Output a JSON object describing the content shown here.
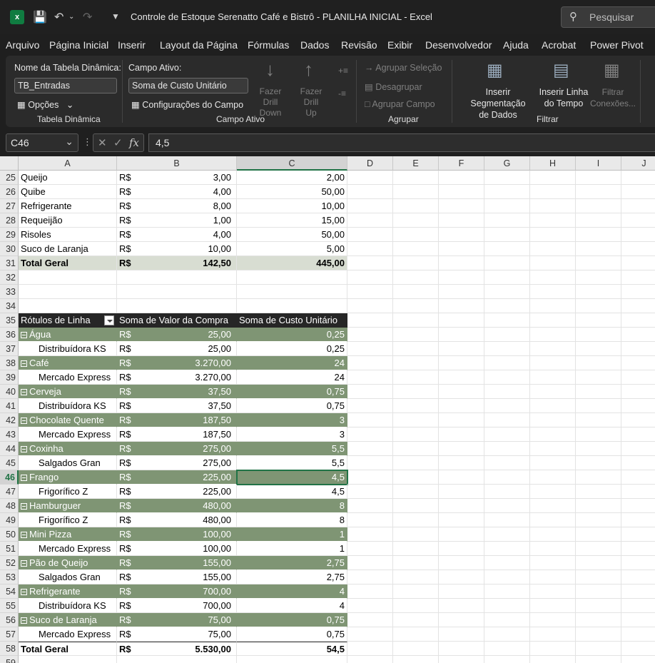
{
  "app": {
    "title": "Controle de Estoque Serenatto Café e Bistrô - PLANILHA INICIAL  -  Excel",
    "icon": "excel-icon",
    "search_placeholder": "Pesquisar"
  },
  "menu": [
    "Arquivo",
    "Página Inicial",
    "Inserir",
    "Layout da Página",
    "Fórmulas",
    "Dados",
    "Revisão",
    "Exibir",
    "Desenvolvedor",
    "Ajuda",
    "Acrobat",
    "Power Pivot"
  ],
  "ribbon": {
    "pivot_name_label": "Nome da Tabela Dinâmica:",
    "pivot_name_value": "TB_Entradas",
    "options_label": "Opções",
    "group_pivot": "Tabela Dinâmica",
    "active_field_label": "Campo Ativo:",
    "active_field_value": "Soma de Custo Unitário",
    "field_settings_label": "Configurações do Campo",
    "drill_down_1": "Fazer Drill",
    "drill_down_2": "Down",
    "drill_up_1": "Fazer Drill",
    "drill_up_2": "Up",
    "group_active_field": "Campo Ativo",
    "group_selection": "Agrupar Seleção",
    "ungroup": "Desagrupar",
    "group_field": "Agrupar Campo",
    "group_group": "Agrupar",
    "insert_slicer_1": "Inserir Segmentação",
    "insert_slicer_2": "de Dados",
    "insert_timeline_1": "Inserir Linha",
    "insert_timeline_2": "do Tempo",
    "filter_conn_1": "Filtrar",
    "filter_conn_2": "Conexões...",
    "group_filter": "Filtrar"
  },
  "formula_bar": {
    "name_box": "C46",
    "formula": "4,5"
  },
  "columns": [
    "A",
    "B",
    "C",
    "D",
    "E",
    "F",
    "G",
    "H",
    "I",
    "J"
  ],
  "rows": [
    {
      "n": "25",
      "type": "plain",
      "a": "Queijo",
      "cur": "R$",
      "b": "3,00",
      "c": "2,00"
    },
    {
      "n": "26",
      "type": "plain",
      "a": "Quibe",
      "cur": "R$",
      "b": "4,00",
      "c": "50,00"
    },
    {
      "n": "27",
      "type": "plain",
      "a": "Refrigerante",
      "cur": "R$",
      "b": "8,00",
      "c": "10,00"
    },
    {
      "n": "28",
      "type": "plain",
      "a": "Requeijão",
      "cur": "R$",
      "b": "1,00",
      "c": "15,00"
    },
    {
      "n": "29",
      "type": "plain",
      "a": "Risoles",
      "cur": "R$",
      "b": "4,00",
      "c": "50,00"
    },
    {
      "n": "30",
      "type": "plain",
      "a": "Suco de Laranja",
      "cur": "R$",
      "b": "10,00",
      "c": "5,00"
    },
    {
      "n": "31",
      "type": "total1",
      "a": "Total Geral",
      "cur": "R$",
      "b": "142,50",
      "c": "445,00"
    },
    {
      "n": "32",
      "type": "empty"
    },
    {
      "n": "33",
      "type": "empty"
    },
    {
      "n": "34",
      "type": "empty"
    },
    {
      "n": "35",
      "type": "header",
      "a": "Rótulos de Linha",
      "b": "Soma de Valor da Compra",
      "c": "Soma de Custo Unitário"
    },
    {
      "n": "36",
      "type": "group",
      "a": "Água",
      "cur": "R$",
      "b": "25,00",
      "c": "0,25"
    },
    {
      "n": "37",
      "type": "item",
      "a": "Distribuídora KS",
      "cur": "R$",
      "b": "25,00",
      "c": "0,25"
    },
    {
      "n": "38",
      "type": "group",
      "a": "Café",
      "cur": "R$",
      "b": "3.270,00",
      "c": "24"
    },
    {
      "n": "39",
      "type": "item",
      "a": "Mercado Express",
      "cur": "R$",
      "b": "3.270,00",
      "c": "24"
    },
    {
      "n": "40",
      "type": "group",
      "a": "Cerveja",
      "cur": "R$",
      "b": "37,50",
      "c": "0,75"
    },
    {
      "n": "41",
      "type": "item",
      "a": "Distribuídora KS",
      "cur": "R$",
      "b": "37,50",
      "c": "0,75"
    },
    {
      "n": "42",
      "type": "group",
      "a": "Chocolate Quente",
      "cur": "R$",
      "b": "187,50",
      "c": "3"
    },
    {
      "n": "43",
      "type": "item",
      "a": "Mercado Express",
      "cur": "R$",
      "b": "187,50",
      "c": "3"
    },
    {
      "n": "44",
      "type": "group",
      "a": "Coxinha",
      "cur": "R$",
      "b": "275,00",
      "c": "5,5"
    },
    {
      "n": "45",
      "type": "item",
      "a": "Salgados Gran",
      "cur": "R$",
      "b": "275,00",
      "c": "5,5"
    },
    {
      "n": "46",
      "type": "group",
      "a": "Frango",
      "cur": "R$",
      "b": "225,00",
      "c": "4,5",
      "active": true
    },
    {
      "n": "47",
      "type": "item",
      "a": "Frigorífico Z",
      "cur": "R$",
      "b": "225,00",
      "c": "4,5"
    },
    {
      "n": "48",
      "type": "group",
      "a": "Hamburguer",
      "cur": "R$",
      "b": "480,00",
      "c": "8"
    },
    {
      "n": "49",
      "type": "item",
      "a": "Frigorífico Z",
      "cur": "R$",
      "b": "480,00",
      "c": "8"
    },
    {
      "n": "50",
      "type": "group",
      "a": "Mini Pizza",
      "cur": "R$",
      "b": "100,00",
      "c": "1"
    },
    {
      "n": "51",
      "type": "item",
      "a": "Mercado Express",
      "cur": "R$",
      "b": "100,00",
      "c": "1"
    },
    {
      "n": "52",
      "type": "group",
      "a": "Pão de Queijo",
      "cur": "R$",
      "b": "155,00",
      "c": "2,75"
    },
    {
      "n": "53",
      "type": "item",
      "a": "Salgados Gran",
      "cur": "R$",
      "b": "155,00",
      "c": "2,75"
    },
    {
      "n": "54",
      "type": "group",
      "a": "Refrigerante",
      "cur": "R$",
      "b": "700,00",
      "c": "4"
    },
    {
      "n": "55",
      "type": "item",
      "a": "Distribuídora KS",
      "cur": "R$",
      "b": "700,00",
      "c": "4"
    },
    {
      "n": "56",
      "type": "group",
      "a": "Suco de Laranja",
      "cur": "R$",
      "b": "75,00",
      "c": "0,75"
    },
    {
      "n": "57",
      "type": "item",
      "a": "Mercado Express",
      "cur": "R$",
      "b": "75,00",
      "c": "0,75"
    },
    {
      "n": "58",
      "type": "total2",
      "a": "Total Geral",
      "cur": "R$",
      "b": "5.530,00",
      "c": "54,5"
    },
    {
      "n": "59",
      "type": "empty"
    }
  ]
}
